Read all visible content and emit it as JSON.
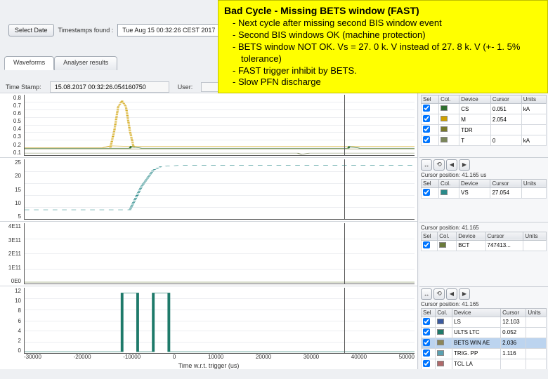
{
  "topbar": {
    "select_date": "Select Date",
    "ts_label": "Timestamps found :",
    "ts_value": "Tue Aug 15 00:32:26 CEST 2017"
  },
  "tabs": {
    "waveforms": "Waveforms",
    "analyser": "Analyser results"
  },
  "tsrow": {
    "ts_label": "Time Stamp:",
    "ts_value": "15.08.2017 00:32:26.054160750",
    "user_label": "User:"
  },
  "note": {
    "title": "Bad Cycle - Missing BETS window (FAST)",
    "items": [
      "Next cycle after missing second BIS window event",
      "Second BIS windows OK (machine protection)",
      "BETS window NOT OK. Vs = 27. 0 k. V instead of 27. 8 k. V (+- 1. 5% tolerance)",
      "FAST trigger inhibit by BETS.",
      "Slow PFN discharge"
    ]
  },
  "legend_headers": {
    "sel": "Sel",
    "col": "Col.",
    "device": "Device",
    "cursor": "Cursor",
    "units": "Units"
  },
  "cursor_position_label": "Cursor position:",
  "axes_units": "us",
  "chart_data": [
    {
      "type": "line",
      "y_ticks": [
        "0.8",
        "0.7",
        "0.6",
        "0.5",
        "0.4",
        "0.3",
        "0.2",
        "0.1"
      ],
      "cursor_x": 41165,
      "series": [
        {
          "name": "CS",
          "color": "#2e6e2e",
          "cursor": 0.051,
          "units": "kA",
          "data": "flat ~0.10 across, small blips near x≈-7000 and x≈41000"
        },
        {
          "name": "M",
          "color": "#cfa000",
          "cursor": 2.054,
          "units": "",
          "data": "flat ~0.12 with single dashed gaussian peak to ~0.8 centered x≈-11000"
        },
        {
          "name": "TDR",
          "color": "#7a7a2a",
          "cursor": "",
          "units": "",
          "data": "flat ~0.12"
        },
        {
          "name": "T",
          "color": "#7a865a",
          "cursor": -0.0,
          "units": "kA",
          "data": "flat ~0.0 with tiny dip near x≈32000"
        }
      ]
    },
    {
      "type": "line",
      "y_ticks": [
        "25",
        "20",
        "15",
        "10",
        "5"
      ],
      "cursor_x": 41165,
      "cursor_readout": "41.165",
      "series": [
        {
          "name": "VS",
          "color": "#2a8a8a",
          "cursor": 27.054,
          "units": "",
          "data": "≈5 until step at x≈-7000 then rises to ≈27 and holds (dashed)"
        }
      ]
    },
    {
      "type": "line",
      "y_ticks": [
        "4E11",
        "3E11",
        "2E11",
        "1E11",
        "0E0"
      ],
      "cursor_x": 41165,
      "cursor_readout": "41.165",
      "series": [
        {
          "name": "BCT",
          "color": "#6a7a3a",
          "cursor": "747413...",
          "units": "",
          "data": "flat near 0"
        }
      ]
    },
    {
      "type": "line",
      "y_ticks": [
        "12",
        "10",
        "8",
        "6",
        "4",
        "2",
        "0"
      ],
      "cursor_x": 41165,
      "cursor_readout": "41.165",
      "x_ticks": [
        "-30000",
        "-20000",
        "-10000",
        "0",
        "10000",
        "20000",
        "30000",
        "40000",
        "50000"
      ],
      "xlabel": "Time w.r.t. trigger (us)",
      "series": [
        {
          "name": "LS",
          "color": "#3a5aa0",
          "cursor": 12.103,
          "units": "",
          "data": "0 baseline"
        },
        {
          "name": "ULTS LTC",
          "color": "#1e7a6a",
          "cursor": "0.052",
          "units": "",
          "data": "two rect pulses 0→12 around x≈-9000 and x≈-2000"
        },
        {
          "name": "BETS WIN AE",
          "color": "#8a865a",
          "cursor": "2.036",
          "units": "",
          "data": "0 baseline",
          "selected": true
        },
        {
          "name": "TRIG. PP",
          "color": "#5aa0b0",
          "cursor": "1.116",
          "units": "",
          "data": "0 baseline"
        },
        {
          "name": "TCL LA",
          "color": "#b06a6a",
          "cursor": "",
          "units": "",
          "data": "0 baseline"
        }
      ]
    }
  ]
}
